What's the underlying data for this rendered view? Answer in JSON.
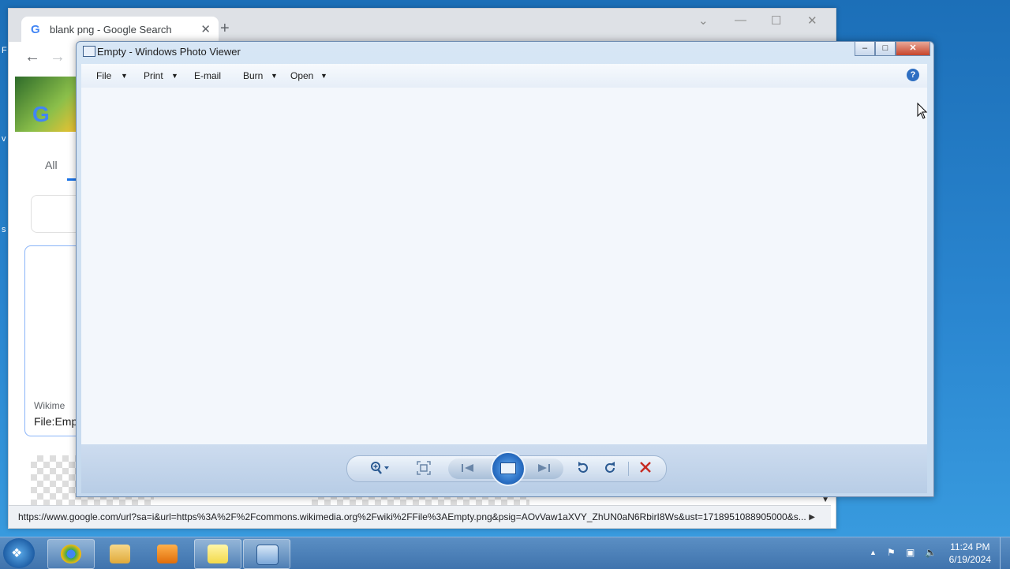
{
  "chrome": {
    "tab_title": "blank png - Google Search",
    "google_glyph": "G",
    "results_tab_all": "All",
    "card_source": "Wikime",
    "card_title": "File:Emp",
    "status_url": "https://www.google.com/url?sa=i&url=https%3A%2F%2Fcommons.wikimedia.org%2Fwiki%2FFile%3AEmpty.png&psig=AOvVaw1aXVY_ZhUN0aN6RbirI8Ws&ust=1718951088905000&s..."
  },
  "photo_viewer": {
    "title": "Empty - Windows Photo Viewer",
    "menu": {
      "file": "File",
      "print": "Print",
      "email": "E-mail",
      "burn": "Burn",
      "open": "Open"
    },
    "help_glyph": "?"
  },
  "taskbar": {
    "time": "11:24 PM",
    "date": "6/19/2024"
  },
  "icons": {
    "close": "✕",
    "plus": "+",
    "back": "←",
    "forward": "→",
    "caret": "▼"
  }
}
